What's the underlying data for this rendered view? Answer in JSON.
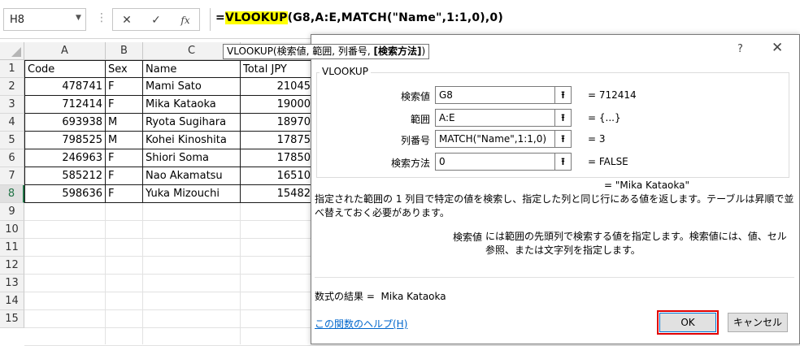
{
  "formula_bar": {
    "name_box": "H8",
    "name_box_arrow": "▼",
    "cancel_glyph": "✕",
    "enter_glyph": "✓",
    "fx_glyph": "fx",
    "formula_eq": "=",
    "formula_func": "VLOOKUP",
    "formula_rest": "(G8,A:E,MATCH(\"Name\",1:1,0),0)"
  },
  "tooltip": {
    "text": "VLOOKUP(検索値, 範囲, 列番号, ",
    "bold": "[検索方法]",
    "close": ")"
  },
  "columns": [
    "A",
    "B",
    "C"
  ],
  "row_numbers": [
    "1",
    "2",
    "3",
    "4",
    "5",
    "6",
    "7",
    "8",
    "9",
    "10",
    "11",
    "12",
    "13",
    "14",
    "15"
  ],
  "table": {
    "headers": [
      "Code",
      "Sex",
      "Name",
      "Total JPY"
    ],
    "rows": [
      [
        "478741",
        "F",
        "Mami Sato",
        "21045"
      ],
      [
        "712414",
        "F",
        "Mika Kataoka",
        "19000"
      ],
      [
        "693938",
        "M",
        "Ryota Sugihara",
        "18970"
      ],
      [
        "798525",
        "M",
        "Kohei Kinoshita",
        "17875"
      ],
      [
        "246963",
        "F",
        "Shiori Soma",
        "17850"
      ],
      [
        "585212",
        "F",
        "Nao Akamatsu",
        "16510"
      ],
      [
        "598636",
        "F",
        "Yuka Mizouchi",
        "15482"
      ]
    ]
  },
  "dialog": {
    "help_glyph": "?",
    "close_glyph": "✕",
    "group_label": "VLOOKUP",
    "args": [
      {
        "label": "検索値",
        "value": "G8",
        "result": "=  712414"
      },
      {
        "label": "範囲",
        "value": "A:E",
        "result": "=  {...}"
      },
      {
        "label": "列番号",
        "value": "MATCH(\"Name\",1:1,0)",
        "result": "=  3"
      },
      {
        "label": "検索方法",
        "value": "0",
        "result": "=  FALSE"
      }
    ],
    "ref_button_glyph": "⭱",
    "overall_result": "=  \"Mika Kataoka\"",
    "description": "指定された範囲の 1 列目で特定の値を検索し、指定した列と同じ行にある値を返します。テーブルは昇順で並べ替えておく必要があります。",
    "arg_name": "検索値",
    "arg_description": "には範囲の先頭列で検索する値を指定します。検索値には、値、セル参照、または文字列を指定します。",
    "result_label": "数式の結果 =",
    "result_value": "Mika Kataoka",
    "help_link": "この関数のヘルプ(H)",
    "ok": "OK",
    "cancel": "キャンセル"
  }
}
